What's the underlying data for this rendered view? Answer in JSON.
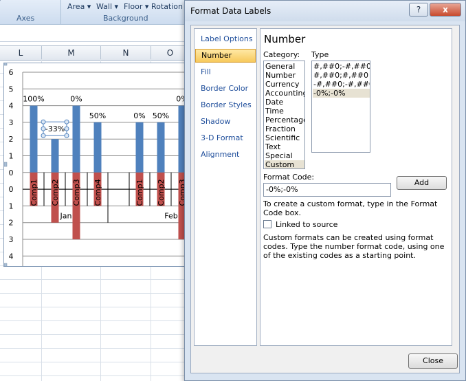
{
  "ribbon": {
    "items": [
      {
        "text": "Axes"
      },
      {
        "text": "Area ▾"
      },
      {
        "text": "Wall ▾"
      },
      {
        "text": "Floor ▾"
      },
      {
        "text": "Rotation"
      },
      {
        "text": "Background"
      }
    ]
  },
  "grid": {
    "columns": [
      "L",
      "M",
      "N",
      "O"
    ]
  },
  "chart_data": {
    "type": "bar",
    "y_ticks": [
      "6",
      "5",
      "4",
      "3",
      "2",
      "1",
      "0",
      "0",
      "1",
      "2",
      "3",
      "4",
      "5"
    ],
    "positive_series": {
      "color": "#4f81bd",
      "values": [
        4,
        2,
        4,
        3,
        3,
        3,
        4
      ]
    },
    "negative_series": {
      "color": "#c0504d",
      "values": [
        2,
        3,
        4,
        2,
        2,
        2,
        4
      ]
    },
    "percent_labels": [
      "100%",
      "-33%",
      "0%",
      "50%",
      "0%",
      "50%",
      "0%"
    ],
    "category_labels": [
      "Comp1",
      "Comp2",
      "Comp3",
      "Comp4",
      "Comp1",
      "Comp2",
      "Comp3"
    ],
    "group_labels": [
      "Jan",
      "Feb"
    ]
  },
  "dialog": {
    "title": "Format Data Labels",
    "help_label": "?",
    "minimize_label": "_",
    "close_label": "x",
    "sidebar": [
      "Label Options",
      "Number",
      "Fill",
      "Border Color",
      "Border Styles",
      "Shadow",
      "3-D Format",
      "Alignment"
    ],
    "panel": {
      "title": "Number",
      "category_label": "Category:",
      "type_label": "Type",
      "categories": [
        "General",
        "Number",
        "Currency",
        "Accounting",
        "Date",
        "Time",
        "Percentage",
        "Fraction",
        "Scientific",
        "Text",
        "Special",
        "Custom"
      ],
      "types": [
        "#,##0;-#,##0",
        "#,##0;#,##0",
        "-#,##0;-#,##0",
        "-0%;-0%"
      ],
      "format_code_label": "Format Code:",
      "format_code_value": "-0%;-0%",
      "add_label": "Add",
      "help_text": "To create a custom format, type in the Format Code box.",
      "linked_label": "Linked to source",
      "description": "Custom formats can be created using format codes. Type the number format code, using one of the existing codes as a starting point."
    },
    "close_button_label": "Close"
  }
}
